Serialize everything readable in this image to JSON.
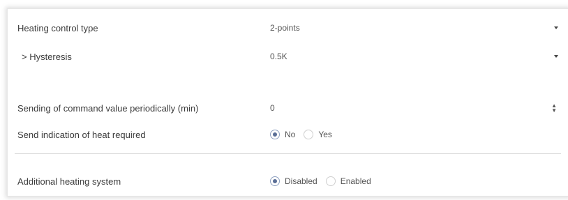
{
  "settings": {
    "heating_control_type": {
      "label": "Heating control type",
      "value": "2-points"
    },
    "hysteresis": {
      "label": "> Hysteresis",
      "value": "0.5K"
    },
    "command_period": {
      "label": "Sending of command value periodically (min)",
      "value": "0"
    },
    "heat_required": {
      "label": "Send indication of heat required",
      "options": [
        "No",
        "Yes"
      ],
      "selected": "No"
    },
    "additional_heating": {
      "label": "Additional heating system",
      "options": [
        "Disabled",
        "Enabled"
      ],
      "selected": "Disabled"
    }
  },
  "icons": {
    "dropdown": "chevron-down-icon",
    "spinner": "spinner-arrows-icon"
  },
  "colors": {
    "radio_selected": "#5a6e96",
    "divider": "#dcdcdc"
  }
}
